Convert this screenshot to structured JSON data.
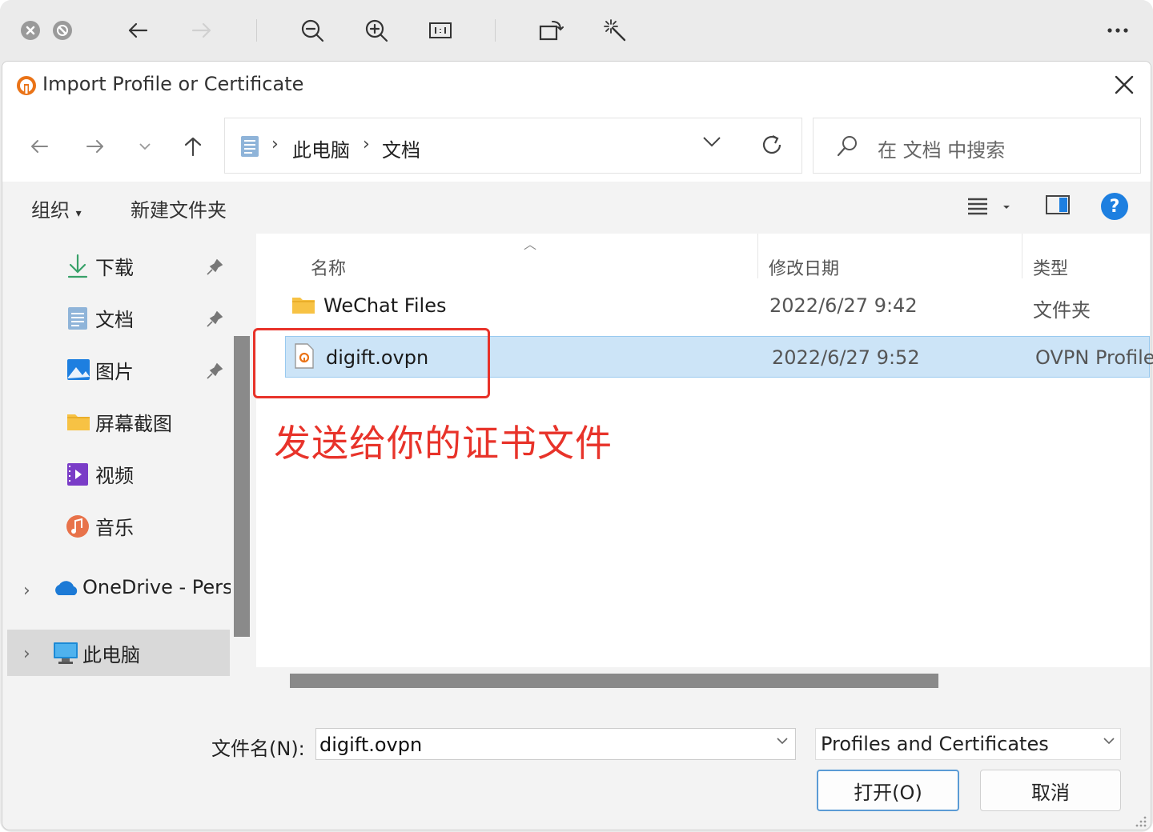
{
  "dialog": {
    "title": "Import Profile or Certificate"
  },
  "address": {
    "crumbs": [
      "此电脑",
      "文档"
    ],
    "search_placeholder": "在 文档 中搜索"
  },
  "commands": {
    "organize": "组织",
    "new_folder": "新建文件夹",
    "help": "?"
  },
  "sidebar": {
    "items": [
      {
        "label": "下载",
        "icon": "download-icon",
        "pinned": true
      },
      {
        "label": "文档",
        "icon": "document-icon",
        "pinned": true
      },
      {
        "label": "图片",
        "icon": "pictures-icon",
        "pinned": true
      },
      {
        "label": "屏幕截图",
        "icon": "folder-icon",
        "pinned": false
      },
      {
        "label": "视频",
        "icon": "video-icon",
        "pinned": false
      },
      {
        "label": "音乐",
        "icon": "music-icon",
        "pinned": false
      },
      {
        "label": "OneDrive - Pers",
        "icon": "onedrive-icon",
        "pinned": false
      },
      {
        "label": "此电脑",
        "icon": "computer-icon",
        "pinned": false
      }
    ]
  },
  "columns": [
    "名称",
    "修改日期",
    "类型"
  ],
  "files": [
    {
      "name": "WeChat Files",
      "date": "2022/6/27 9:42",
      "type": "文件夹",
      "icon": "folder-icon"
    },
    {
      "name": "digift.ovpn",
      "date": "2022/6/27 9:52",
      "type": "OVPN Profile",
      "icon": "ovpn-file-icon"
    }
  ],
  "annotation": {
    "text": "发送给你的证书文件",
    "color": "#e8332a"
  },
  "footer": {
    "filename_label": "文件名(N):",
    "filename_value": "digift.ovpn",
    "filetype_value": "Profiles and Certificates",
    "open_label": "打开(O)",
    "cancel_label": "取消"
  },
  "colors": {
    "accent": "#1d7fe0",
    "selection": "#cce4f7",
    "annotation": "#e8332a"
  }
}
